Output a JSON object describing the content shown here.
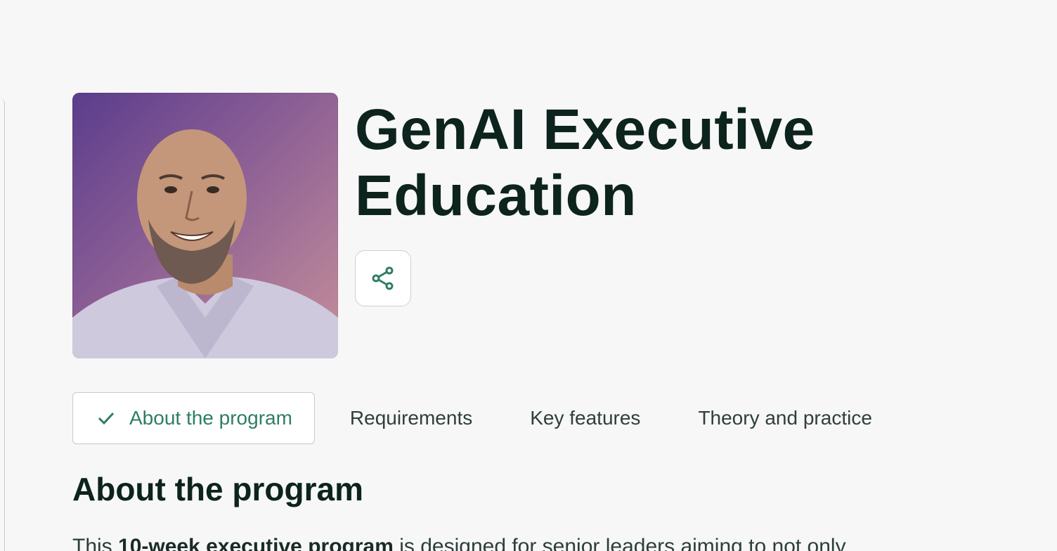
{
  "hero": {
    "title": "GenAI Executive Education",
    "photo_alt": "Program instructor portrait",
    "share_icon": "share-icon"
  },
  "tabs": [
    {
      "label": "About the program",
      "active": true,
      "icon": "check-icon"
    },
    {
      "label": "Requirements",
      "active": false
    },
    {
      "label": "Key features",
      "active": false
    },
    {
      "label": "Theory and practice",
      "active": false
    }
  ],
  "section": {
    "title": "About the program",
    "intro_before": "This ",
    "intro_bold": "10-week executive program",
    "intro_after": " is designed for senior leaders aiming to not only"
  },
  "colors": {
    "accent": "#2f7d66",
    "heading": "#0d231d",
    "background": "#f7f7f7"
  }
}
